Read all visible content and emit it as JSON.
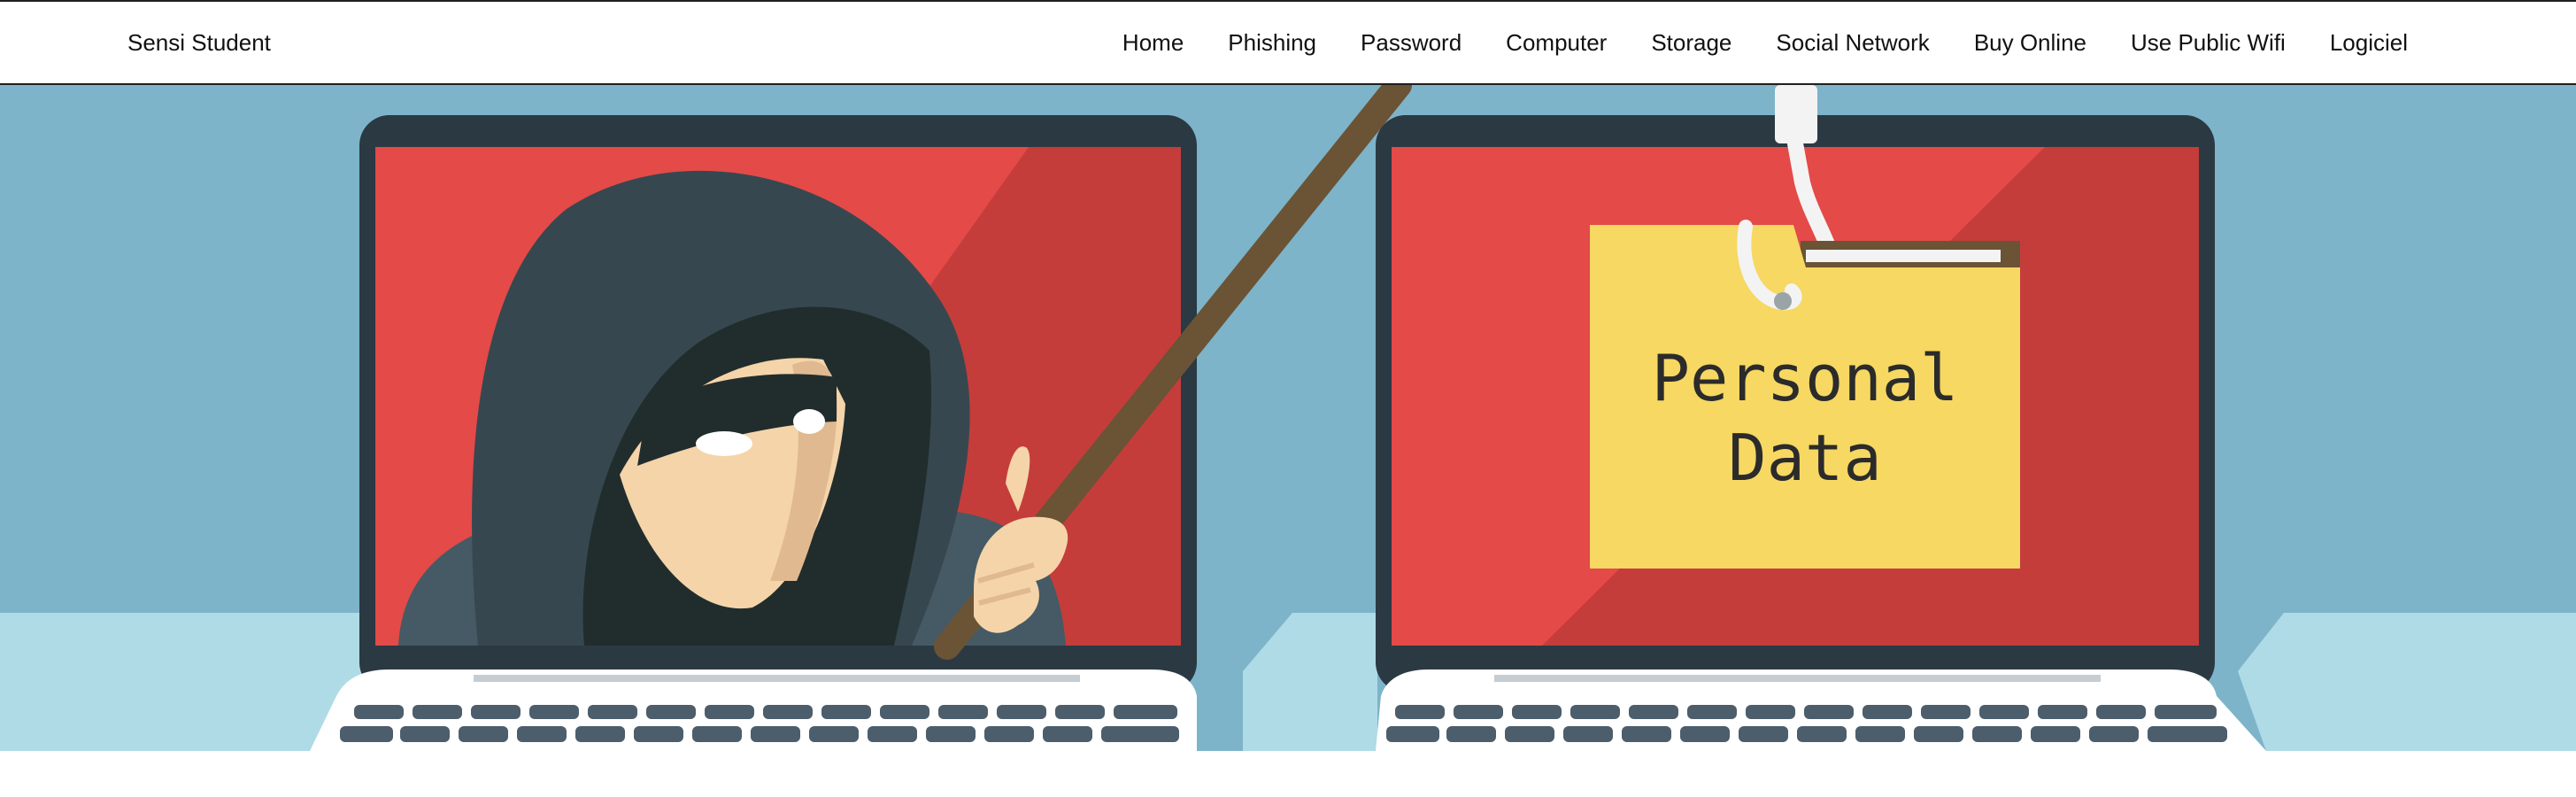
{
  "site": {
    "brand": "Sensi Student"
  },
  "nav": {
    "items": [
      {
        "label": "Home"
      },
      {
        "label": "Phishing"
      },
      {
        "label": "Password"
      },
      {
        "label": "Computer"
      },
      {
        "label": "Storage"
      },
      {
        "label": "Social Network"
      },
      {
        "label": "Buy Online"
      },
      {
        "label": "Use Public Wifi"
      },
      {
        "label": "Logiciel"
      }
    ]
  },
  "hero": {
    "folder_line1": "Personal",
    "folder_line2": "Data"
  },
  "colors": {
    "sky": "#7db4c9",
    "floor": "#aedbe6",
    "screen_red": "#e34a48",
    "screen_red_dark": "#c43d3b",
    "laptop_frame": "#2b3943",
    "folder": "#f6d862",
    "rod": "#6b5335",
    "hood": "#37474f"
  },
  "icons": [
    "hacker-illustration",
    "fishing-hook-icon",
    "folder-icon",
    "laptop-icon"
  ]
}
